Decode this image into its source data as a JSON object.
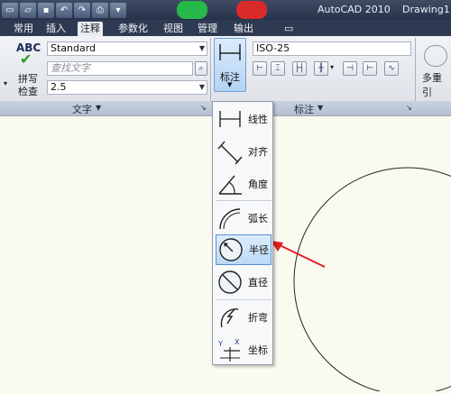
{
  "window": {
    "app_title": "AutoCAD 2010",
    "doc_title": "Drawing1."
  },
  "tabs": [
    "常用",
    "插入",
    "注释",
    "参数化",
    "视图",
    "管理",
    "输出"
  ],
  "active_tab": "注释",
  "text_panel": {
    "spell_abc": "ABC",
    "spell_label_1": "拼写",
    "spell_label_2": "检查",
    "style_value": "Standard",
    "find_placeholder": "查找文字",
    "height_value": "2.5",
    "panel_title": "文字"
  },
  "dim_panel": {
    "dim_button_label": "标注",
    "dim_style_value": "ISO-25",
    "panel_title": "标注"
  },
  "multileader_label": "多重引",
  "dim_menu": {
    "items": [
      {
        "label": "线性",
        "icon": "linear-dim-icon"
      },
      {
        "label": "对齐",
        "icon": "aligned-dim-icon"
      },
      {
        "label": "角度",
        "icon": "angular-dim-icon"
      },
      {
        "label": "弧长",
        "icon": "arc-length-icon"
      },
      {
        "label": "半径",
        "icon": "radius-icon",
        "selected": true
      },
      {
        "label": "直径",
        "icon": "diameter-icon"
      },
      {
        "label": "折弯",
        "icon": "jogged-icon"
      },
      {
        "label": "坐标",
        "icon": "ordinate-icon"
      }
    ]
  },
  "colors": {
    "accent_selected": "#bcd9f6",
    "annotation_arrow": "#e02020",
    "canvas": "#fbfaf1"
  }
}
